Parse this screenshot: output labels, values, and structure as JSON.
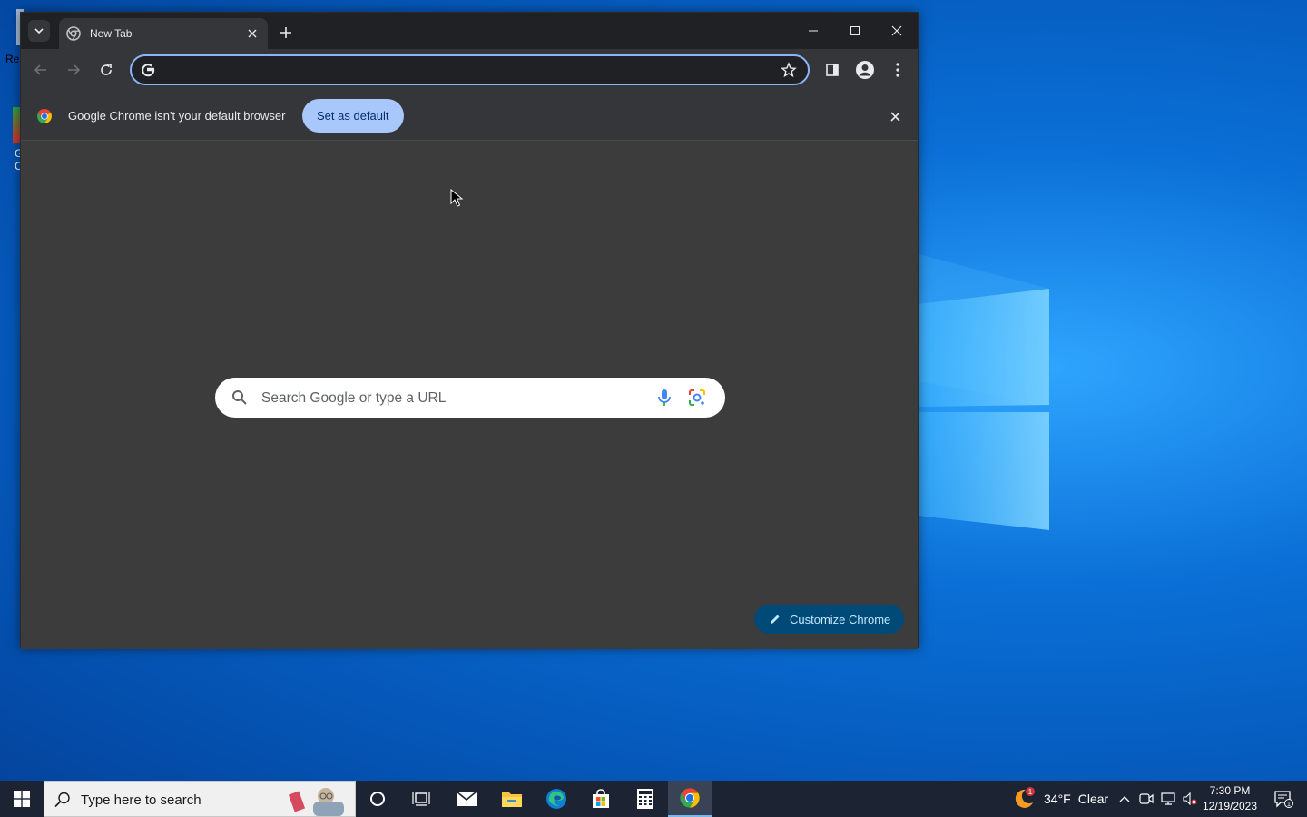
{
  "desktop": {
    "left_fragments": [
      "Re",
      "G",
      "C"
    ]
  },
  "browser": {
    "tab": {
      "title": "New Tab"
    },
    "window_controls": [
      "minimize",
      "maximize",
      "close"
    ],
    "omnibox": {
      "value": "",
      "placeholder": ""
    },
    "infobar": {
      "message": "Google Chrome isn't your default browser",
      "button_label": "Set as default"
    },
    "ntp": {
      "search_placeholder": "Search Google or type a URL",
      "customize_label": "Customize Chrome"
    }
  },
  "taskbar": {
    "search_placeholder": "Type here to search",
    "apps": [
      "cortana",
      "task-view",
      "mail",
      "file-explorer",
      "edge",
      "store",
      "calculator",
      "chrome"
    ],
    "active_app": "chrome",
    "weather": {
      "temp": "34°F",
      "condition": "Clear",
      "badge": "1"
    },
    "clock": {
      "time": "7:30 PM",
      "date": "12/19/2023"
    },
    "notifications_count": "1"
  },
  "colors": {
    "chrome_frame": "#202124",
    "chrome_toolbar": "#35363a",
    "ntp_background": "#3c3c3c",
    "accent_blue": "#a8c7fa",
    "omnibox_focus": "#8ab4f8",
    "taskbar": "#1c2433"
  }
}
